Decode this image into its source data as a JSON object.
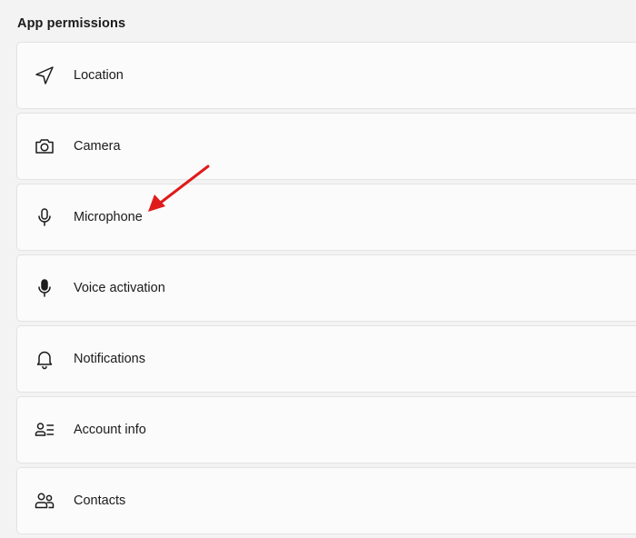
{
  "section": {
    "title": "App permissions"
  },
  "items": [
    {
      "label": "Location",
      "icon": "location-arrow-icon"
    },
    {
      "label": "Camera",
      "icon": "camera-icon"
    },
    {
      "label": "Microphone",
      "icon": "microphone-icon"
    },
    {
      "label": "Voice activation",
      "icon": "voice-activation-microphone-icon"
    },
    {
      "label": "Notifications",
      "icon": "bell-icon"
    },
    {
      "label": "Account info",
      "icon": "account-info-icon"
    },
    {
      "label": "Contacts",
      "icon": "contacts-icon"
    }
  ],
  "annotation": {
    "arrow_color": "#e01b1b",
    "target": "Microphone"
  },
  "colors": {
    "background": "#f3f3f3",
    "card": "#fbfbfb",
    "card_border": "#e3e3e3",
    "text": "#1b1b1b"
  }
}
